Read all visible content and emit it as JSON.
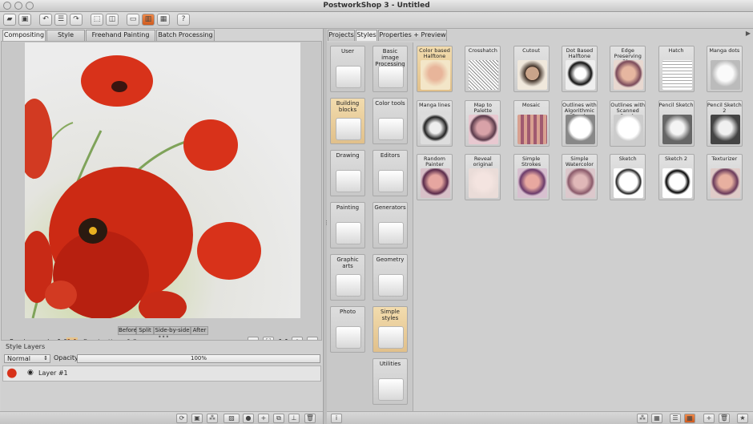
{
  "window": {
    "title": "PostworkShop 3 - Untitled"
  },
  "toolbar": {
    "help_label": "?"
  },
  "left_tabs": [
    "Compositing",
    "Style Editor",
    "Freehand Painting",
    "Batch Processing"
  ],
  "view_modes": [
    "Before",
    "Split",
    "Side-by-side",
    "After"
  ],
  "status": {
    "preview_scale_label": "Preview scale: 1.00",
    "scale_badge": "1:1",
    "render_time": "Render time: 1.2 sec",
    "zoom_one": "1:1"
  },
  "layers": {
    "header": "Style Layers",
    "blend_mode": "Normal",
    "opacity_label": "Opacity:",
    "opacity_value": "100%",
    "layer_name": "Layer #1"
  },
  "right_tabs": [
    "Projects",
    "Styles",
    "Properties + Preview"
  ],
  "categories": [
    {
      "label": "User"
    },
    {
      "label": "Basic image Processing"
    },
    {
      "label": "Building blocks"
    },
    {
      "label": "Color tools"
    },
    {
      "label": "Drawing"
    },
    {
      "label": "Editors"
    },
    {
      "label": "Painting"
    },
    {
      "label": "Generators"
    },
    {
      "label": "Graphic arts"
    },
    {
      "label": "Geometry"
    },
    {
      "label": "Photo"
    },
    {
      "label": "Simple styles"
    },
    {
      "label": "Utilities"
    }
  ],
  "styles": [
    {
      "label": "Color based Halftone"
    },
    {
      "label": "Crosshatch"
    },
    {
      "label": "Cutout"
    },
    {
      "label": "Dot Based Halftone"
    },
    {
      "label": "Edge Preserving Blur"
    },
    {
      "label": "Hatch"
    },
    {
      "label": "Manga dots"
    },
    {
      "label": "Manga lines"
    },
    {
      "label": "Map to Palette"
    },
    {
      "label": "Mosaic"
    },
    {
      "label": "Outlines with Algorithmic Brush"
    },
    {
      "label": "Outlines with Scanned Brush"
    },
    {
      "label": "Pencil Sketch"
    },
    {
      "label": "Pencil Sketch 2"
    },
    {
      "label": "Random Painter"
    },
    {
      "label": "Reveal original"
    },
    {
      "label": "Simple Strokes"
    },
    {
      "label": "Simple Watercolor"
    },
    {
      "label": "Sketch"
    },
    {
      "label": "Sketch 2"
    },
    {
      "label": "Texturizer"
    }
  ],
  "info_label": "i",
  "colors": {
    "selected": "#e8c98f",
    "poppy": "#d8321a"
  }
}
